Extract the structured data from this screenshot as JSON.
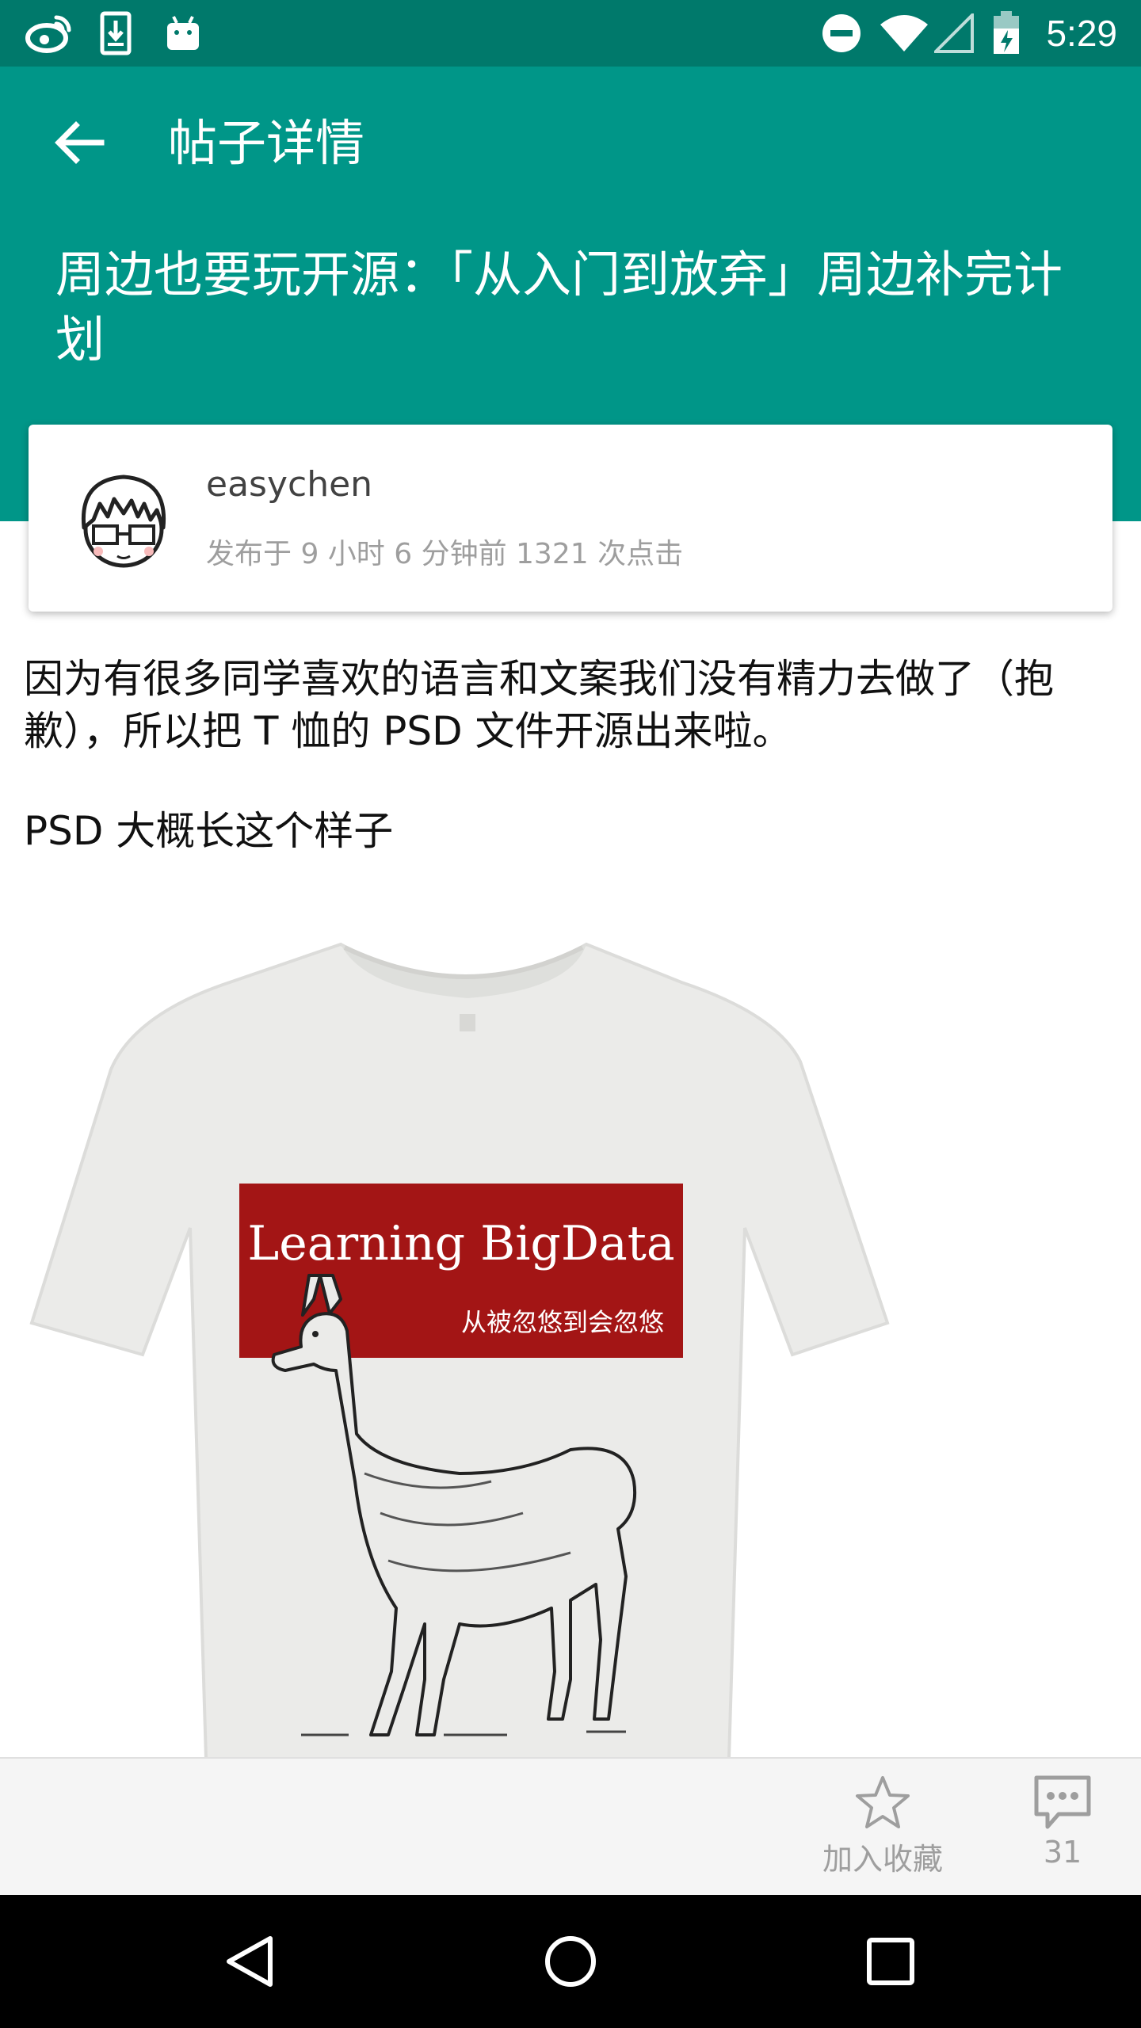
{
  "status_bar": {
    "time": "5:29",
    "icons": [
      "weibo-icon",
      "download-icon",
      "android-icon",
      "do-not-disturb-icon",
      "wifi-icon",
      "signal-icon",
      "battery-icon"
    ]
  },
  "toolbar": {
    "title": "帖子详情",
    "back_icon": "arrow-back-icon"
  },
  "post": {
    "title": "周边也要玩开源：「从入门到放弃」周边补完计划",
    "author": "easychen",
    "meta": "发布于 9 小时 6 分钟前 1321 次点击",
    "paragraph1": "因为有很多同学喜欢的语言和文案我们没有精力去做了（抱歉），所以把 T 恤的 PSD 文件开源出来啦。",
    "paragraph2": "PSD 大概长这个样子",
    "image": {
      "banner_title": "Learning BigData",
      "banner_subtitle": "从被忽悠到会忽悠"
    }
  },
  "actions": {
    "favorite_label": "加入收藏",
    "comment_count": "31"
  },
  "colors": {
    "status_bar": "#00796b",
    "header": "#009688",
    "banner_red": "#a31515"
  }
}
